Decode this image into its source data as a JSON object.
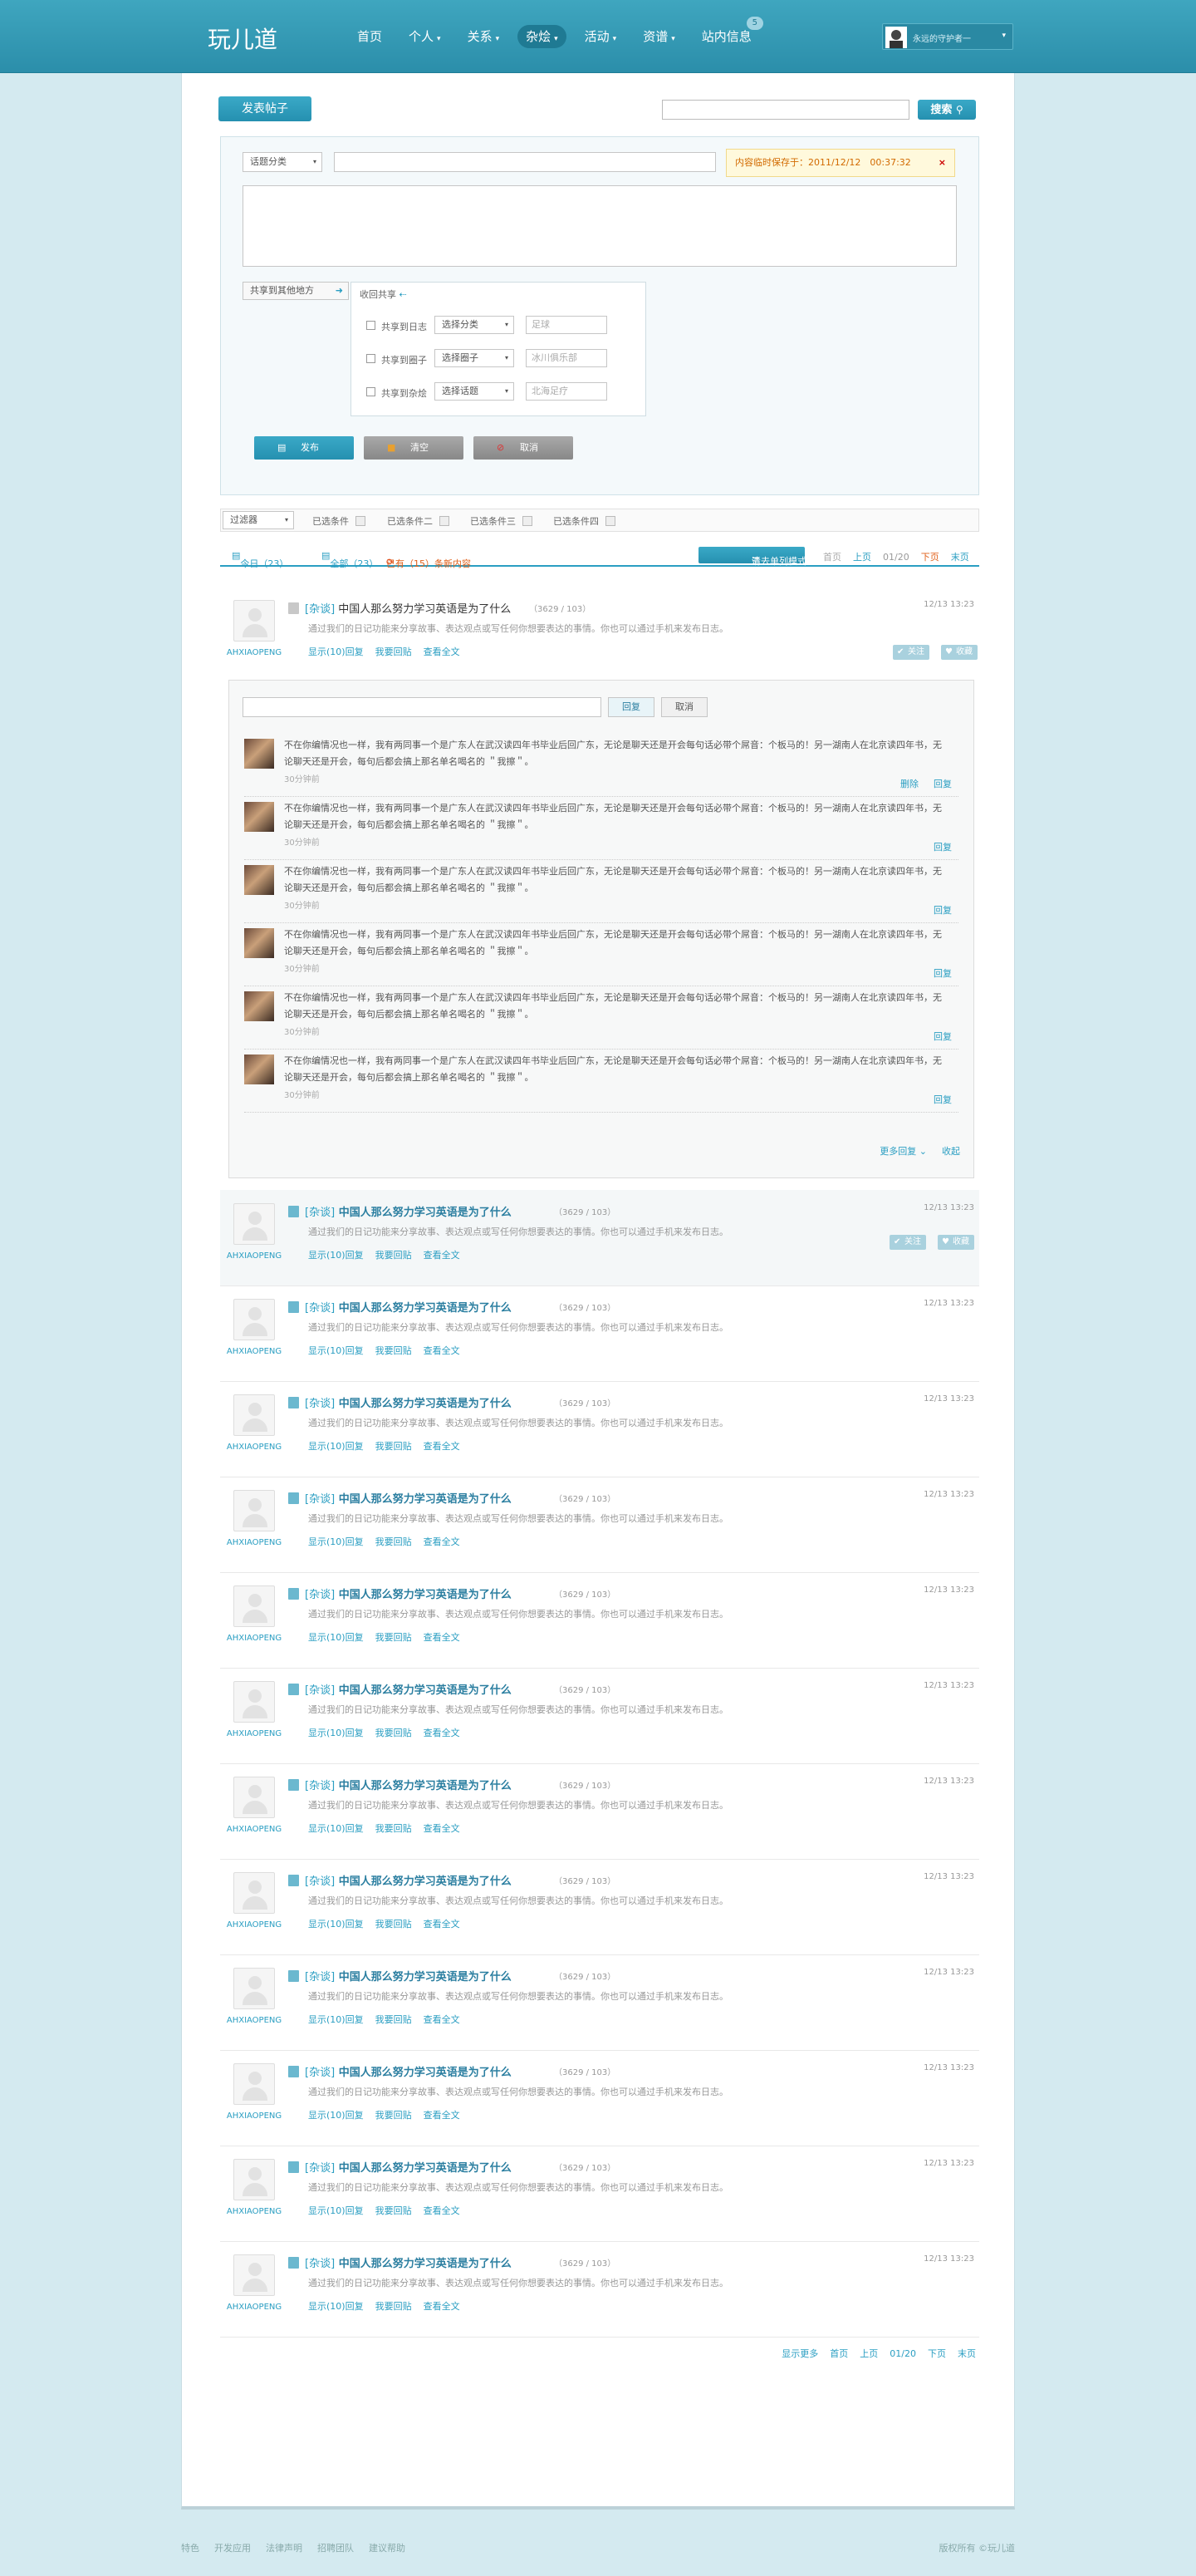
{
  "header": {
    "logo": "玩儿道",
    "nav": [
      {
        "label": "首页",
        "caret": false
      },
      {
        "label": "个人",
        "caret": true
      },
      {
        "label": "关系",
        "caret": true
      },
      {
        "label": "杂烩",
        "caret": true,
        "active": true
      },
      {
        "label": "活动",
        "caret": true
      },
      {
        "label": "资谱",
        "caret": true
      },
      {
        "label": "站内信息",
        "caret": false,
        "badge": "5"
      }
    ],
    "user_name": "永远的守护者一"
  },
  "toolbar": {
    "post_button": "发表帖子",
    "search_button": "搜索"
  },
  "compose": {
    "topic_select": "话题分类",
    "notice": "内容临时保存于：2011/12/12　00:37:32",
    "notice_close": "×",
    "share_other": "共享到其他地方",
    "share_back": "收回共享",
    "share_rows": [
      {
        "label": "共享到日志",
        "select": "选择分类",
        "placeholder": "足球"
      },
      {
        "label": "共享到圈子",
        "select": "选择圈子",
        "placeholder": "冰川俱乐部"
      },
      {
        "label": "共享到杂烩",
        "select": "选择话题",
        "placeholder": "北海足疗"
      }
    ],
    "publish": "发布",
    "clear": "清空",
    "cancel": "取消"
  },
  "filter": {
    "label": "过滤器",
    "conditions": [
      "已选条件",
      "已选条件二",
      "已选条件三",
      "已选条件四"
    ]
  },
  "tabs": {
    "today": "今日（23）",
    "all": "全部（23）",
    "new": "已有（15）条新内容",
    "list_mode": "清去单列模式",
    "pager": [
      "首页",
      "上页",
      "01/20",
      "下页",
      "末页"
    ]
  },
  "first_post": {
    "category": "[杂谈]",
    "title": "中国人那么努力学习英语是为了什么",
    "count": "（3629 / 103）",
    "summary": "通过我们的日记功能来分享故事、表达观点或写任何你想要表达的事情。你也可以通过手机来发布日志。",
    "links": [
      "显示(10)回复",
      "我要回贴",
      "查看全文"
    ],
    "time": "12/13 13:23",
    "user": "AHXIAOPENG",
    "follow": "关注",
    "collect": "收藏"
  },
  "reply_box": {
    "reply": "回复",
    "cancel": "取消"
  },
  "comments": [
    {
      "text": "不在你编情况也一样，我有两同事一个是广东人在武汉读四年书毕业后回广东，无论是聊天还是开会每句话必带个屌音：个板马的！另一湖南人在北京读四年书，无论聊天还是开会，每句后都会搞上那名单名喝名的 ＂我擦＂。",
      "time": "30分钟前",
      "ops": [
        "删除",
        "回复"
      ]
    },
    {
      "text": "不在你编情况也一样，我有两同事一个是广东人在武汉读四年书毕业后回广东，无论是聊天还是开会每句话必带个屌音：个板马的！另一湖南人在北京读四年书，无论聊天还是开会，每句后都会搞上那名单名喝名的 ＂我擦＂。",
      "time": "30分钟前",
      "ops": [
        "回复"
      ]
    },
    {
      "text": "不在你编情况也一样，我有两同事一个是广东人在武汉读四年书毕业后回广东，无论是聊天还是开会每句话必带个屌音：个板马的！另一湖南人在北京读四年书，无论聊天还是开会，每句后都会搞上那名单名喝名的 ＂我擦＂。",
      "time": "30分钟前",
      "ops": [
        "回复"
      ]
    },
    {
      "text": "不在你编情况也一样，我有两同事一个是广东人在武汉读四年书毕业后回广东，无论是聊天还是开会每句话必带个屌音：个板马的！另一湖南人在北京读四年书，无论聊天还是开会，每句后都会搞上那名单名喝名的 ＂我擦＂。",
      "time": "30分钟前",
      "ops": [
        "回复"
      ]
    },
    {
      "text": "不在你编情况也一样，我有两同事一个是广东人在武汉读四年书毕业后回广东，无论是聊天还是开会每句话必带个屌音：个板马的！另一湖南人在北京读四年书，无论聊天还是开会，每句后都会搞上那名单名喝名的 ＂我擦＂。",
      "time": "30分钟前",
      "ops": [
        "回复"
      ]
    },
    {
      "text": "不在你编情况也一样，我有两同事一个是广东人在武汉读四年书毕业后回广东，无论是聊天还是开会每句话必带个屌音：个板马的！另一湖南人在北京读四年书，无论聊天还是开会，每句后都会搞上那名单名喝名的 ＂我擦＂。",
      "time": "30分钟前",
      "ops": [
        "回复"
      ]
    }
  ],
  "comments_footer": {
    "more": "更多回复 ⌄",
    "collapse": "收起"
  },
  "post": {
    "category": "[杂谈]",
    "title": "中国人那么努力学习英语是为了什么",
    "count": "（3629 / 103）",
    "summary": "通过我们的日记功能来分享故事、表达观点或写任何你想要表达的事情。你也可以通过手机来发布日志。",
    "links": [
      "显示(10)回复",
      "我要回贴",
      "查看全文"
    ],
    "time": "12/13 13:23",
    "user": "AHXIAOPENG",
    "follow": "关注",
    "collect": "收藏"
  },
  "bottom_pager": [
    "显示更多",
    "首页",
    "上页",
    "01/20",
    "下页",
    "末页"
  ],
  "footer": {
    "links": [
      "特色",
      "开发应用",
      "法律声明",
      "招聘团队",
      "建议帮助"
    ],
    "copyright": "版权所有 ©玩儿道"
  },
  "colors": {
    "header": "#2b8eaa",
    "accent": "#2a9ec2",
    "background": "#d4eaf0"
  }
}
